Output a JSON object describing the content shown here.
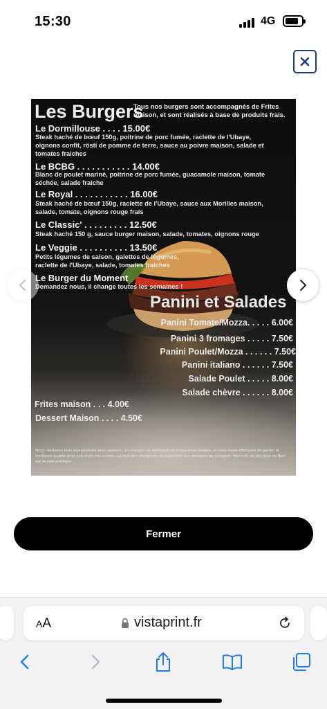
{
  "status_bar": {
    "time": "15:30",
    "network": "4G"
  },
  "menu": {
    "title": "Les Burgers",
    "intro": "Tous nos burgers sont accompagnés de Frites maison, et sont réalisés à base de produits frais.",
    "burgers": [
      {
        "name": "Le Dormillouse . . . . 15.00€",
        "desc": "Steak haché de bœuf 150g, poitrine de porc fumée, raclette de l'Ubaye, oignons confit, rösti de pomme de terre, sauce au poivre maison, salade et tomates fraiches"
      },
      {
        "name": "Le BCBG . . . . . . . . . . . 14.00€",
        "desc": "Blanc de poulet mariné, poitrine de porc fumée, guacamole maison, tomate séchée, salade fraiche"
      },
      {
        "name": "Le Royal . . . . . . . . . . . 16.00€",
        "desc": "Steak haché de bœuf 150g, raclette de l'Ubaye, sauce aux Morilles maison, salade, tomate, oignons rouge frais"
      },
      {
        "name": "Le Classic' . . . . . . . . . 12.50€",
        "desc": "Steak haché 150 g, sauce burger maison, salade, tomates, oignons rouge"
      },
      {
        "name": "Le Veggie . . . . . . . . . . 13.50€",
        "desc": "Petits légumes de saison, galettes de légumes, raclette de l'Ubaye, salade, tomates fraiches"
      },
      {
        "name": "Le Burger du Moment",
        "desc": "Demandez nous, il change toutes les semaines !"
      }
    ],
    "panini_title": "Panini et Salades",
    "panini": [
      "Panini Tomate/Mozza. . . . . 6.00€",
      "Panini 3 fromages . . . . . 7.50€",
      "Panini Poulet/Mozza . . . . . . 7.50€",
      "Panini italiano . . . . . . 7.50€",
      "Salade Poulet . . . . . 8.00€",
      "Salade chèvre . . . . . . 8.00€"
    ],
    "extras": [
      "Frites maison . . . 4.00€",
      "Dessert Maison . . . . 4.50€"
    ],
    "footer": "Nous réalisons tous nos produits avec passion, en utilisant un maximum de ressources locales, et nous nous efforçons de garder la meilleure qualité pour satisfaire vos envies. La liste des allergènes et disponible sur demande au comptoir. Merci de ne pas jeter ce flyer sur la voie publique."
  },
  "close_button": {
    "label": "Fermer"
  },
  "browser": {
    "text_size_label_small": "A",
    "text_size_label_large": "A",
    "url": "vistaprint.fr"
  },
  "icons": {
    "close": "close-icon",
    "prev": "chevron-left-icon",
    "next": "chevron-right-icon",
    "lock": "lock-icon",
    "reload": "reload-icon",
    "back": "back-icon",
    "forward": "forward-icon",
    "share": "share-icon",
    "bookmarks": "bookmarks-icon",
    "tabs": "tabs-icon"
  },
  "colors": {
    "accent_close": "#1b3f72",
    "browser_blue": "#1a7cf0",
    "button_bg": "#000000"
  }
}
